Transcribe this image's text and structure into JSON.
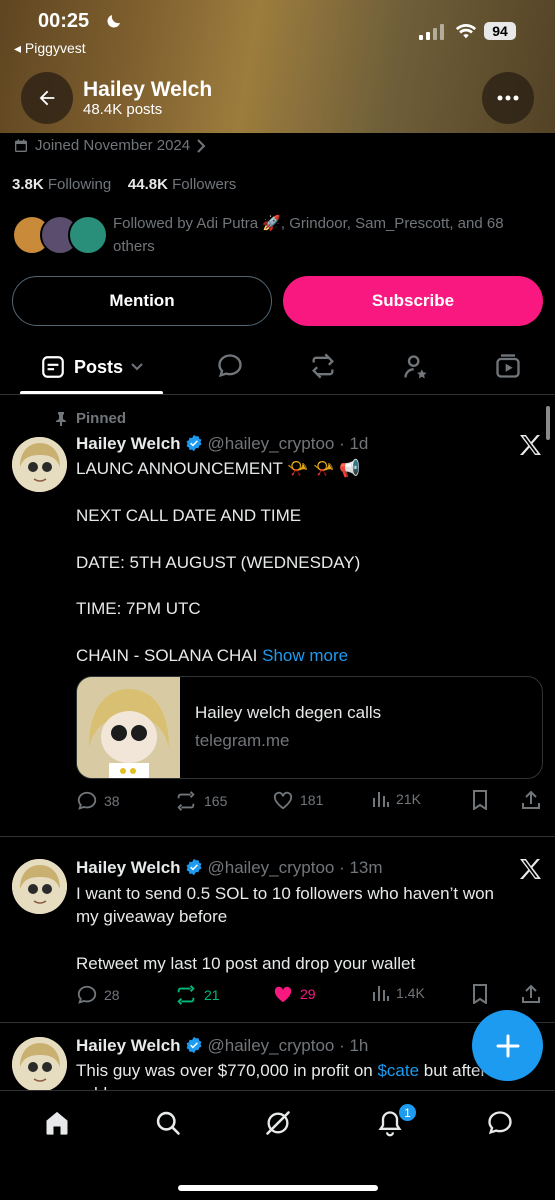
{
  "status_bar": {
    "time": "00:25",
    "back_app": "◂ Piggyvest",
    "battery": "94"
  },
  "header": {
    "title": "Hailey Welch",
    "posts_count": "48.4K posts"
  },
  "profile": {
    "joined": "Joined November 2024",
    "following_count": "3.8K",
    "following_label": "Following",
    "followers_count": "44.8K",
    "followers_label": "Followers",
    "followed_by": "Followed by Adi Putra 🚀, Grindoor, Sam_Prescott, and 68 others"
  },
  "buttons": {
    "mention": "Mention",
    "subscribe": "Subscribe"
  },
  "tabs": {
    "posts": "Posts"
  },
  "posts": [
    {
      "pinned_label": "Pinned",
      "name": "Hailey Welch",
      "handle": "@hailey_cryptoo · 1d",
      "lines": [
        "LAUNC ANNOUNCEMENT 📯 📯 📢",
        "NEXT CALL DATE AND TIME",
        "DATE: 5TH AUGUST  (WEDNESDAY)",
        "TIME: 7PM UTC",
        "CHAIN - SOLANA CHAI"
      ],
      "show_more": "Show more",
      "card_title": "Hailey welch degen calls",
      "card_domain": "telegram.me",
      "replies": "38",
      "reposts": "165",
      "likes": "181",
      "views": "21K"
    },
    {
      "name": "Hailey Welch",
      "handle": "@hailey_cryptoo · 13m",
      "lines": [
        "I want to send 0.5 SOL to 10 followers who haven’t won",
        "my giveaway before",
        "Retweet my last 10 post and drop your wallet"
      ],
      "replies": "28",
      "reposts": "21",
      "likes": "29",
      "views": "1.4K"
    },
    {
      "name": "Hailey Welch",
      "handle": "@hailey_cryptoo · 1h",
      "line_prefix": "This guy was over $770,000 in profit on ",
      "cashtag": "$cate",
      "line_suffix": " but after",
      "line2": "sold"
    }
  ],
  "nav": {
    "notification_count": "1"
  },
  "colors": {
    "accent": "#1d9bf0",
    "subscribe": "#f91880",
    "repost_active": "#00ba7c",
    "like_active": "#f91880"
  }
}
